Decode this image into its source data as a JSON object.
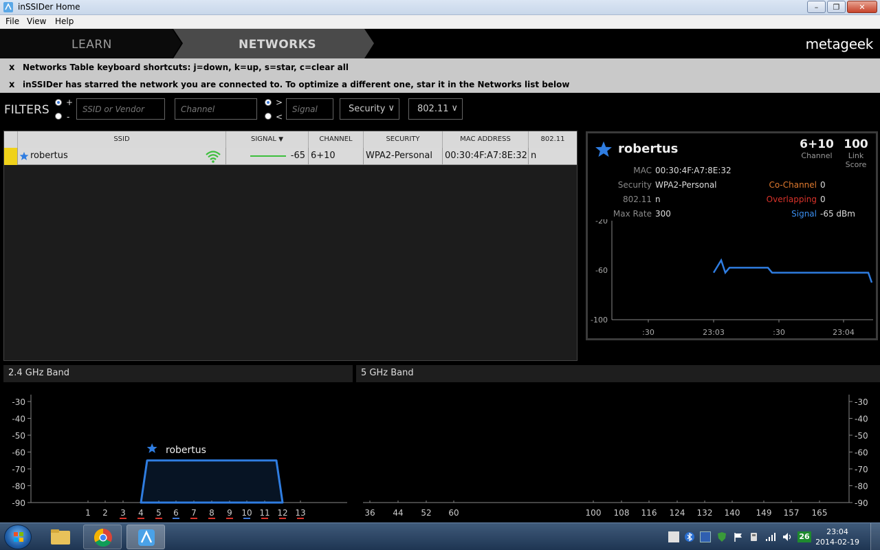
{
  "window": {
    "title": "inSSIDer Home",
    "minimize_icon": "minimize-icon",
    "maximize_icon": "restore-icon",
    "close_icon": "close-icon"
  },
  "menu": [
    "File",
    "View",
    "Help"
  ],
  "nav": {
    "learn": "LEARN",
    "networks": "NETWORKS",
    "brand": "metageek"
  },
  "notices": [
    {
      "close": "x",
      "text": "Networks Table keyboard shortcuts: j=down, k=up, s=star, c=clear all"
    },
    {
      "close": "x",
      "text": "inSSIDer has starred the network you are connected to. To optimize a different one, star it in the Networks list below"
    }
  ],
  "filters": {
    "label": "FILTERS",
    "plus": "+",
    "minus": "-",
    "ssid_placeholder": "SSID or Vendor",
    "channel_placeholder": "Channel",
    "gt": ">",
    "lt": "<",
    "signal_placeholder": "Signal",
    "security": "Security",
    "dot11": "802.11"
  },
  "table": {
    "headers": {
      "ssid": "SSID",
      "signal": "SIGNAL",
      "channel": "CHANNEL",
      "security": "SECURITY",
      "mac": "MAC ADDRESS",
      "dot11": "802.11"
    },
    "rows": [
      {
        "ssid": "robertus",
        "signal": "-65",
        "channel": "6+10",
        "security": "WPA2-Personal",
        "mac": "00:30:4F:A7:8E:32",
        "dot11": "n"
      }
    ]
  },
  "detail": {
    "name": "robertus",
    "channel": "6+10",
    "channel_label": "Channel",
    "link_score": "100",
    "link_score_label": "Link Score",
    "mac_label": "MAC",
    "mac": "00:30:4F:A7:8E:32",
    "security_label": "Security",
    "security": "WPA2-Personal",
    "dot11_label": "802.11",
    "dot11": "n",
    "maxrate_label": "Max Rate",
    "maxrate": "300",
    "cochannel_label": "Co-Channel",
    "cochannel": "0",
    "overlapping_label": "Overlapping",
    "overlapping": "0",
    "signal_label": "Signal",
    "signal": "-65 dBm",
    "colors": {
      "cochannel": "#e07a2e",
      "overlapping": "#d8322a",
      "signal": "#3a8ef0"
    }
  },
  "chart_data": [
    {
      "type": "line",
      "title": "",
      "ylim": [
        -100,
        -20
      ],
      "yticks": [
        "-20",
        "-60",
        "-100"
      ],
      "xticks": [
        ":30",
        "23:03",
        ":30",
        "23:04"
      ],
      "series": [
        {
          "values": [
            -62,
            -52,
            -62,
            -58,
            -58,
            -58,
            -62,
            -62,
            -62,
            -62,
            -70
          ]
        }
      ]
    },
    {
      "type": "area",
      "title": "2.4 GHz Band",
      "ylim": [
        -90,
        -30
      ],
      "yticks": [
        "-30",
        "-40",
        "-50",
        "-60",
        "-70",
        "-80",
        "-90"
      ],
      "categories": [
        "1",
        "2",
        "3",
        "4",
        "5",
        "6",
        "7",
        "8",
        "9",
        "10",
        "11",
        "12",
        "13"
      ],
      "series": [
        {
          "name": "robertus",
          "channel_span": [
            4,
            12
          ],
          "level": -65
        }
      ]
    },
    {
      "type": "area",
      "title": "5 GHz Band",
      "ylim": [
        -90,
        -30
      ],
      "yticks": [
        "-30",
        "-40",
        "-50",
        "-60",
        "-70",
        "-80",
        "-90"
      ],
      "categories": [
        "36",
        "44",
        "52",
        "60",
        "100",
        "108",
        "116",
        "124",
        "132",
        "140",
        "149",
        "157",
        "165"
      ],
      "series": []
    }
  ],
  "taskbar": {
    "time": "23:04",
    "date": "2014-02-19",
    "badge": "26"
  }
}
